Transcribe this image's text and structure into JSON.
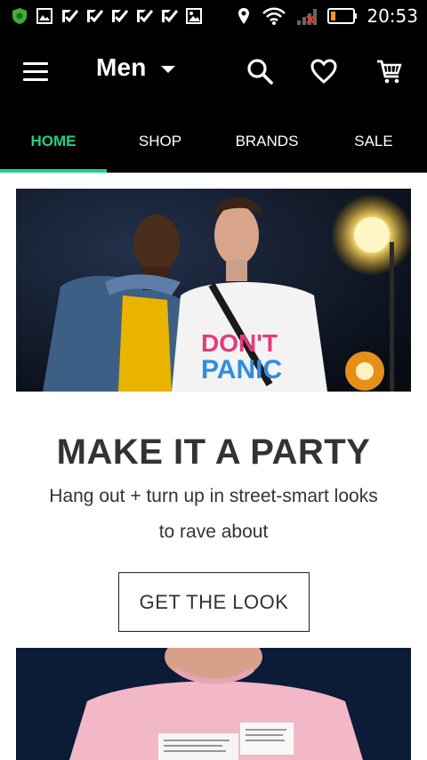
{
  "status_bar": {
    "time": "20:53",
    "icons": [
      "shield-icon",
      "image-icon",
      "check-icon",
      "check-icon",
      "check-icon",
      "check-icon",
      "check-icon",
      "gallery-icon",
      "location-icon",
      "wifi-icon",
      "signal-icon",
      "battery-icon"
    ]
  },
  "header": {
    "title": "Men",
    "icons": [
      "menu-icon",
      "search-icon",
      "heart-icon",
      "cart-icon"
    ]
  },
  "tabs": [
    {
      "label": "HOME",
      "active": true
    },
    {
      "label": "SHOP",
      "active": false
    },
    {
      "label": "BRANDS",
      "active": false
    },
    {
      "label": "SALE",
      "active": false
    }
  ],
  "hero": {
    "shirt_text_line1": "DON'T",
    "shirt_text_line2": "PANIC"
  },
  "promo": {
    "title": "MAKE IT A PARTY",
    "subtitle": "Hang out + turn up in street-smart looks to rave about",
    "cta_label": "GET THE LOOK"
  },
  "colors": {
    "accent": "#1fd18a",
    "bar_bg": "#000000",
    "text": "#333333"
  }
}
